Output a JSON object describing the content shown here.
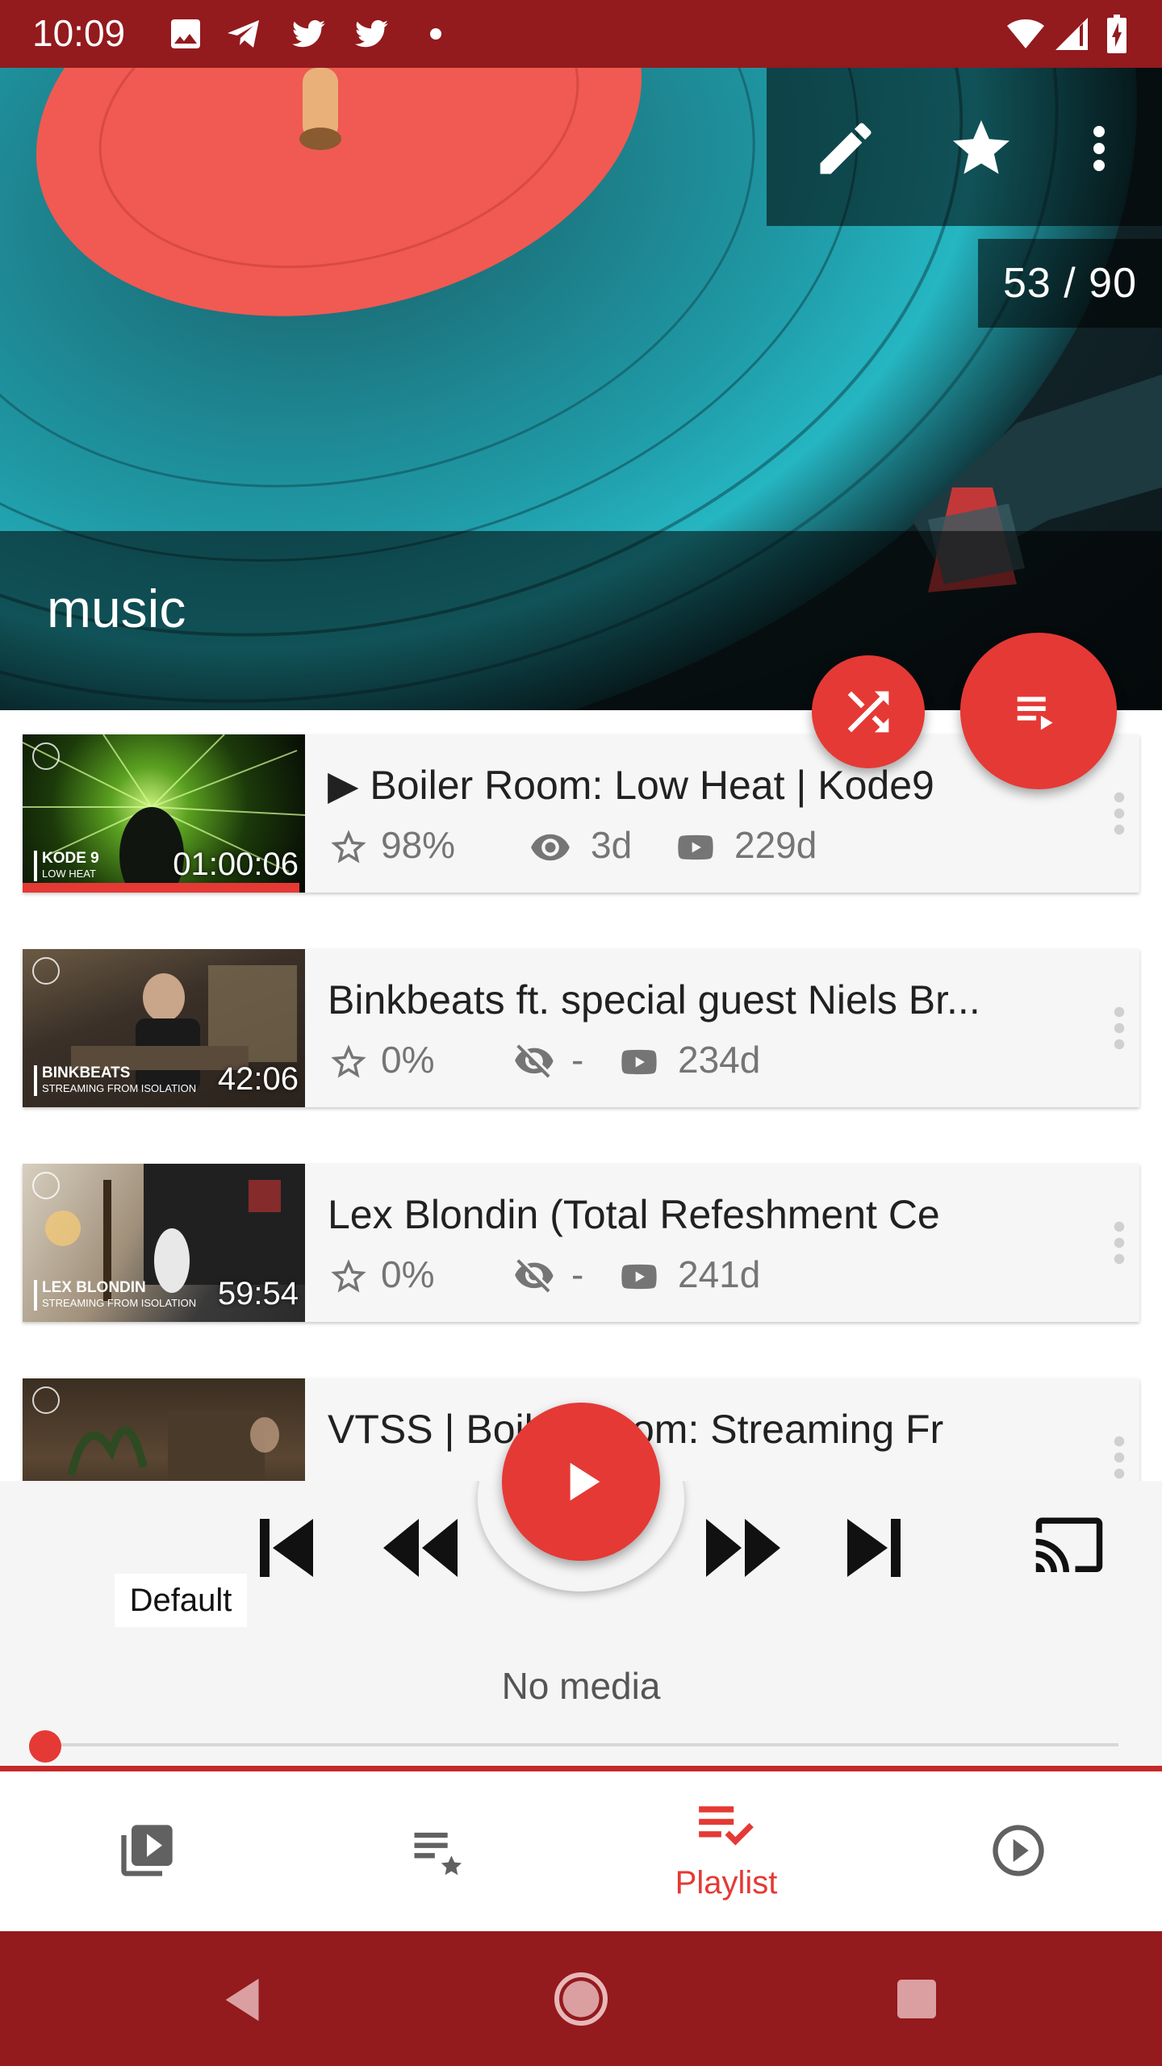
{
  "status_bar": {
    "time": "10:09",
    "notification_icons": [
      "image-icon",
      "telegram-icon",
      "twitter-icon",
      "twitter-icon",
      "dot-icon"
    ],
    "system_icons": [
      "wifi-icon",
      "cellular-icon",
      "battery-charging-icon"
    ]
  },
  "header": {
    "title": "music",
    "count": "53 / 90",
    "actions": [
      "edit-icon",
      "star-icon",
      "more-vert-icon"
    ]
  },
  "videos": [
    {
      "title": "▶ Boiler Room: Low Heat | Kode9",
      "thumb_caption": "KODE 9",
      "thumb_caption_sub": "LOW HEAT",
      "duration": "01:00:06",
      "rating": "98%",
      "watched": "3d",
      "published": "229d",
      "watch_progress": 0.98,
      "seen": true
    },
    {
      "title": "Binkbeats ft. special guest Niels Br...",
      "thumb_caption": "BINKBEATS",
      "thumb_caption_sub": "STREAMING FROM ISOLATION",
      "duration": "42:06",
      "rating": "0%",
      "watched": "-",
      "published": "234d",
      "seen": false
    },
    {
      "title": "Lex Blondin (Total Refeshment Ce",
      "thumb_caption": "LEX BLONDIN",
      "thumb_caption_sub": "STREAMING FROM ISOLATION",
      "duration": "59:54",
      "rating": "0%",
      "watched": "-",
      "published": "241d",
      "seen": false
    },
    {
      "title": "VTSS | Boiler Room: Streaming Fr",
      "thumb_caption": "",
      "thumb_caption_sub": "",
      "duration": "",
      "rating": "",
      "watched": "",
      "published": "",
      "seen": false
    }
  ],
  "player": {
    "default_label": "Default",
    "status": "No media",
    "seek_position": 0
  },
  "bottom_nav": {
    "items": [
      {
        "icon": "video-library-icon",
        "label": ""
      },
      {
        "icon": "playlist-star-icon",
        "label": ""
      },
      {
        "icon": "playlist-check-icon",
        "label": "Playlist",
        "active": true
      },
      {
        "icon": "play-circle-icon",
        "label": ""
      }
    ]
  },
  "colors": {
    "status_bar": "#931a1d",
    "accent_red": "#e53935",
    "accent_blue": "#3949ab"
  }
}
